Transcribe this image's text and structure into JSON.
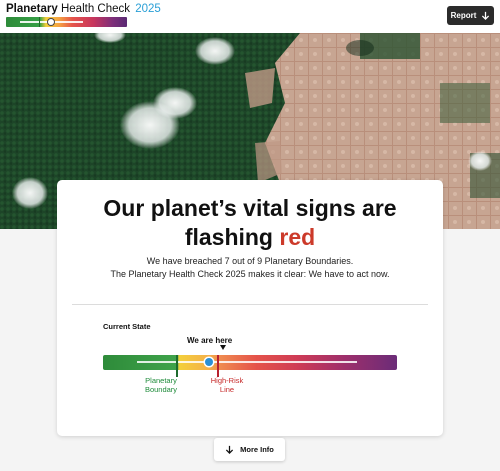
{
  "header": {
    "brand_bold": "Planetary",
    "brand_rest": "Health Check",
    "brand_year": "2025",
    "report_label": "Report",
    "report_icon": "arrow-down-icon"
  },
  "hero": {
    "headline_line1": "Our planet’s vital signs are",
    "headline_line2_prefix": "flashing",
    "headline_highlight": "red",
    "highlight_color": "#cc3a2a",
    "subtext_line1": "We have breached 7 out of 9 Planetary Boundaries.",
    "subtext_line2": "The Planetary Health Check 2025 makes it clear: We have to act now."
  },
  "state": {
    "label": "Current State",
    "pointer_label": "We are here",
    "planetary_boundary_label": "Planetary Boundary",
    "high_risk_label": "High-Risk Line",
    "boundary_color": "#1e8b3a",
    "high_risk_color": "#c62828",
    "marker_color": "#2a8fd6"
  },
  "more_info": {
    "label": "More Info",
    "icon": "arrow-down-icon"
  }
}
